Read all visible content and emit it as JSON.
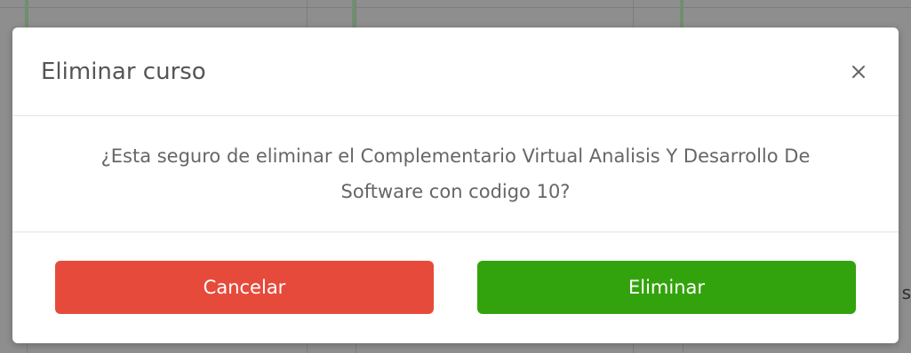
{
  "modal": {
    "title": "Eliminar curso",
    "close_icon": "close-icon",
    "message": "¿Esta seguro de eliminar el Complementario Virtual Analisis Y Desarrollo De Software con codigo 10?",
    "cancel_label": "Cancelar",
    "delete_label": "Eliminar"
  },
  "background": {
    "peek_text": "s"
  },
  "colors": {
    "cancel": "#e64a3b",
    "delete": "#33a30d",
    "overlay": "#8e8e8e",
    "title_text": "#555555",
    "body_text": "#666666"
  }
}
